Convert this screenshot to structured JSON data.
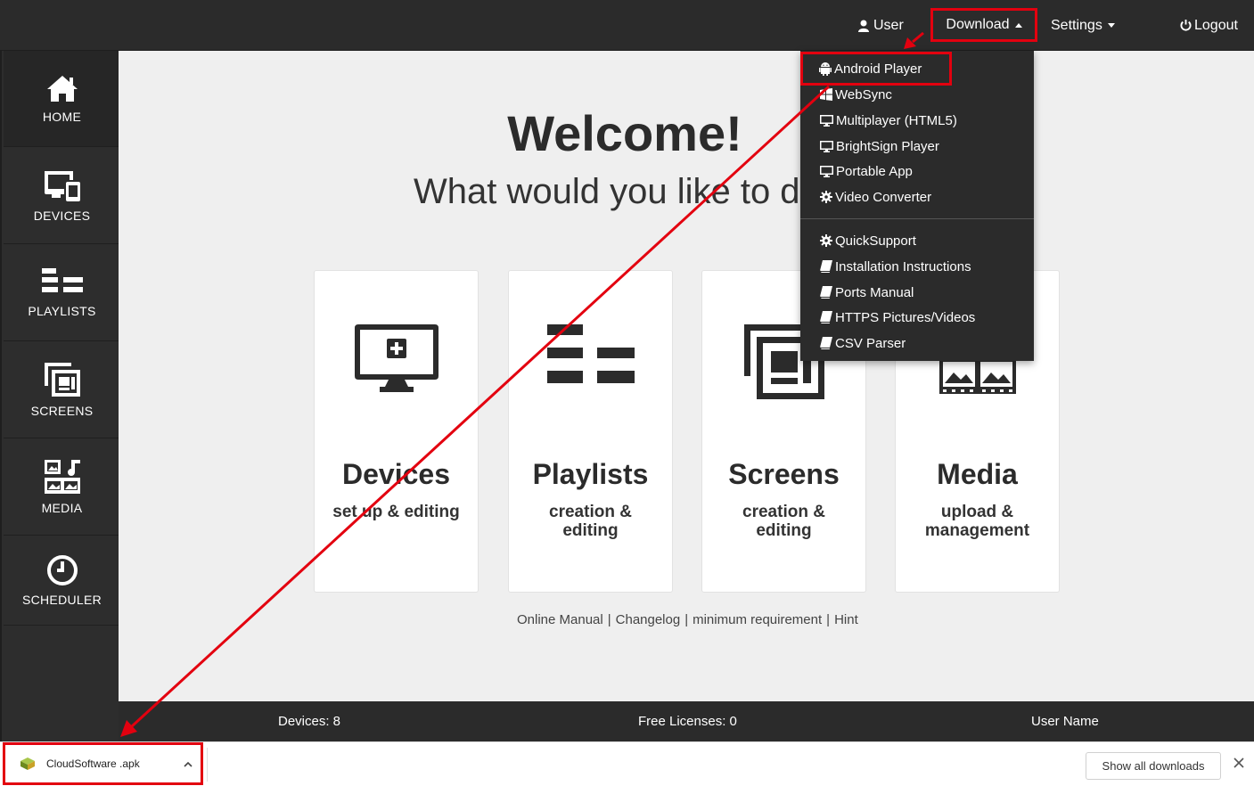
{
  "navbar": {
    "user_label": "User",
    "download_label": "Download",
    "settings_label": "Settings",
    "logout_label": "Logout"
  },
  "sidebar": {
    "items": [
      {
        "label": "HOME",
        "icon": "home-icon"
      },
      {
        "label": "DEVICES",
        "icon": "devices-icon"
      },
      {
        "label": "PLAYLISTS",
        "icon": "playlists-icon"
      },
      {
        "label": "SCREENS",
        "icon": "screens-icon"
      },
      {
        "label": "MEDIA",
        "icon": "media-icon"
      },
      {
        "label": "SCHEDULER",
        "icon": "clock-icon"
      }
    ]
  },
  "main": {
    "title": "Welcome!",
    "subtitle": "What would you like to do?",
    "cards": [
      {
        "title": "Devices",
        "subtitle": "set up & editing",
        "icon": "monitor-plus-icon"
      },
      {
        "title": "Playlists",
        "subtitle": "creation & editing",
        "icon": "playlists-icon"
      },
      {
        "title": "Screens",
        "subtitle": "creation & editing",
        "icon": "screens-icon"
      },
      {
        "title": "Media",
        "subtitle": "upload & management",
        "icon": "filmstrip-icon"
      }
    ],
    "footer_links": [
      "Online Manual",
      "Changelog",
      "minimum requirement",
      "Hint"
    ]
  },
  "download_menu": {
    "items": [
      {
        "label": "Android Player",
        "icon": "android-icon"
      },
      {
        "label": "WebSync",
        "icon": "windows-icon"
      },
      {
        "label": "Multiplayer (HTML5)",
        "icon": "desktop-icon"
      },
      {
        "label": "BrightSign Player",
        "icon": "desktop-icon"
      },
      {
        "label": "Portable App",
        "icon": "desktop-icon"
      },
      {
        "label": "Video Converter",
        "icon": "gear-icon"
      }
    ],
    "support_items": [
      {
        "label": "QuickSupport",
        "icon": "gear-icon"
      },
      {
        "label": "Installation Instructions",
        "icon": "book-icon"
      },
      {
        "label": "Ports Manual",
        "icon": "book-icon"
      },
      {
        "label": "HTTPS Pictures/Videos",
        "icon": "book-icon"
      },
      {
        "label": "CSV Parser",
        "icon": "book-icon"
      }
    ]
  },
  "status": {
    "devices": "Devices: 8",
    "licenses": "Free Licenses: 0",
    "user": "User Name"
  },
  "download_shelf": {
    "filename": "CloudSoftware .apk",
    "show_all": "Show all downloads"
  },
  "colors": {
    "annotation": "#e3000f",
    "navbar": "#2b2b2b",
    "main_bg": "#efefef"
  }
}
